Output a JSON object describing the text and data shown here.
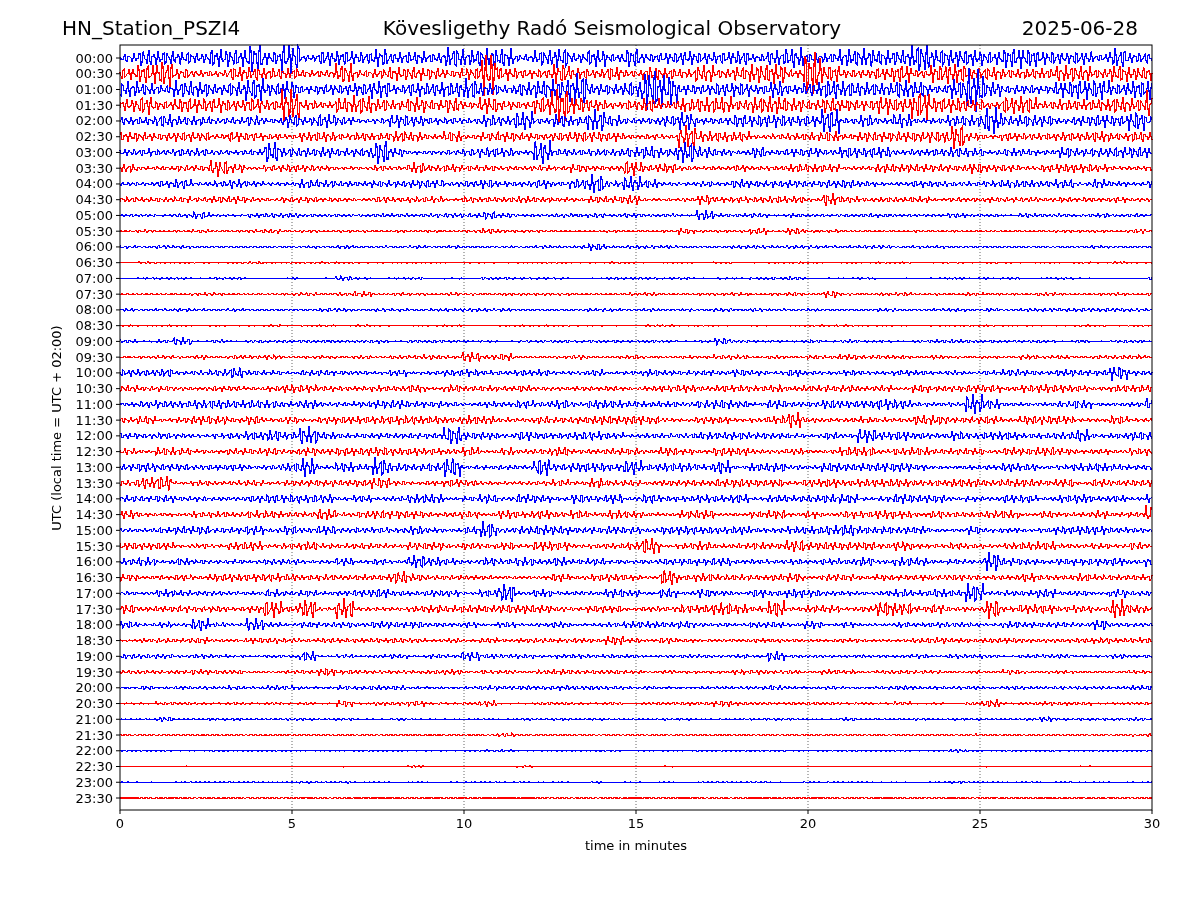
{
  "header": {
    "station": "HN_Station_PSZI4",
    "title": "Kövesligethy Radó Seismological Observatory",
    "date": "2025-06-28"
  },
  "y_axis": {
    "label": "UTC (local time = UTC + 02:00)"
  },
  "x_axis": {
    "label": "time in minutes",
    "ticks": [
      "0",
      "5",
      "10",
      "15",
      "20",
      "25",
      "30"
    ]
  },
  "traces": [
    {
      "label": "00:00",
      "color": "#0000ff"
    },
    {
      "label": "00:30",
      "color": "#ff0000"
    },
    {
      "label": "01:00",
      "color": "#0000ff"
    },
    {
      "label": "01:30",
      "color": "#ff0000"
    },
    {
      "label": "02:00",
      "color": "#0000ff"
    },
    {
      "label": "02:30",
      "color": "#ff0000"
    },
    {
      "label": "03:00",
      "color": "#0000ff"
    },
    {
      "label": "03:30",
      "color": "#ff0000"
    },
    {
      "label": "04:00",
      "color": "#0000ff"
    },
    {
      "label": "04:30",
      "color": "#ff0000"
    },
    {
      "label": "05:00",
      "color": "#0000ff"
    },
    {
      "label": "05:30",
      "color": "#ff0000"
    },
    {
      "label": "06:00",
      "color": "#0000ff"
    },
    {
      "label": "06:30",
      "color": "#ff0000"
    },
    {
      "label": "07:00",
      "color": "#0000ff"
    },
    {
      "label": "07:30",
      "color": "#ff0000"
    },
    {
      "label": "08:00",
      "color": "#0000ff"
    },
    {
      "label": "08:30",
      "color": "#ff0000"
    },
    {
      "label": "09:00",
      "color": "#0000ff"
    },
    {
      "label": "09:30",
      "color": "#ff0000"
    },
    {
      "label": "10:00",
      "color": "#0000ff"
    },
    {
      "label": "10:30",
      "color": "#ff0000"
    },
    {
      "label": "11:00",
      "color": "#0000ff"
    },
    {
      "label": "11:30",
      "color": "#ff0000"
    },
    {
      "label": "12:00",
      "color": "#0000ff"
    },
    {
      "label": "12:30",
      "color": "#ff0000"
    },
    {
      "label": "13:00",
      "color": "#0000ff"
    },
    {
      "label": "13:30",
      "color": "#ff0000"
    },
    {
      "label": "14:00",
      "color": "#0000ff"
    },
    {
      "label": "14:30",
      "color": "#ff0000"
    },
    {
      "label": "15:00",
      "color": "#0000ff"
    },
    {
      "label": "15:30",
      "color": "#ff0000"
    },
    {
      "label": "16:00",
      "color": "#0000ff"
    },
    {
      "label": "16:30",
      "color": "#ff0000"
    },
    {
      "label": "17:00",
      "color": "#0000ff"
    },
    {
      "label": "17:30",
      "color": "#ff0000"
    },
    {
      "label": "18:00",
      "color": "#0000ff"
    },
    {
      "label": "18:30",
      "color": "#ff0000"
    },
    {
      "label": "19:00",
      "color": "#0000ff"
    },
    {
      "label": "19:30",
      "color": "#ff0000"
    },
    {
      "label": "20:00",
      "color": "#0000ff"
    },
    {
      "label": "20:30",
      "color": "#ff0000"
    },
    {
      "label": "21:00",
      "color": "#0000ff"
    },
    {
      "label": "21:30",
      "color": "#ff0000"
    },
    {
      "label": "22:00",
      "color": "#0000ff"
    },
    {
      "label": "22:30",
      "color": "#ff0000"
    },
    {
      "label": "23:00",
      "color": "#0000ff"
    },
    {
      "label": "23:30",
      "color": "#ff0000"
    }
  ]
}
